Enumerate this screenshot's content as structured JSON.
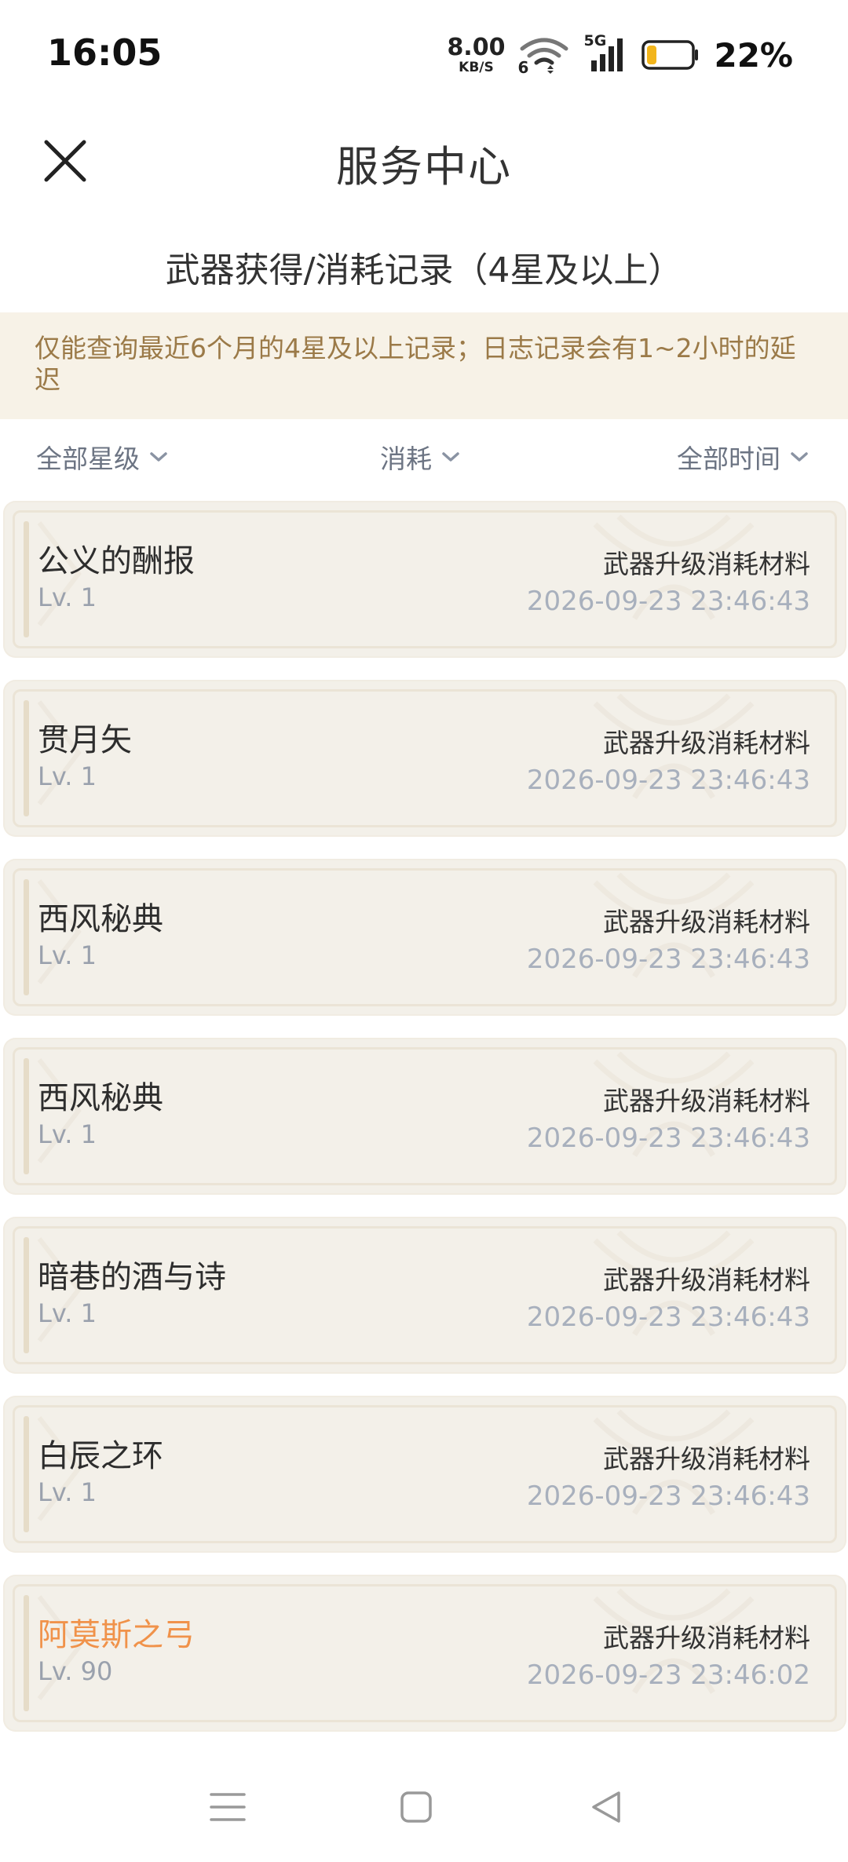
{
  "status_bar": {
    "time": "16:05",
    "net_speed_value": "8.00",
    "net_speed_unit": "KB/S",
    "wifi_sub": "6",
    "signal_label": "5G",
    "battery_percent": "22%",
    "battery_level": 0.22,
    "battery_color": "#f2b51c"
  },
  "header": {
    "title": "服务中心",
    "close_icon": "close-icon"
  },
  "section_title": "武器获得/消耗记录（4星及以上）",
  "notice": "仅能查询最近6个月的4星及以上记录；日志记录会有1~2小时的延迟",
  "filters": [
    {
      "label": "全部星级"
    },
    {
      "label": "消耗"
    },
    {
      "label": "全部时间"
    }
  ],
  "records": [
    {
      "name": "公义的酬报",
      "level": "Lv. 1",
      "reason": "武器升级消耗材料",
      "time": "2026-09-23 23:46:43",
      "rarity": "4"
    },
    {
      "name": "贯月矢",
      "level": "Lv. 1",
      "reason": "武器升级消耗材料",
      "time": "2026-09-23 23:46:43",
      "rarity": "4"
    },
    {
      "name": "西风秘典",
      "level": "Lv. 1",
      "reason": "武器升级消耗材料",
      "time": "2026-09-23 23:46:43",
      "rarity": "4"
    },
    {
      "name": "西风秘典",
      "level": "Lv. 1",
      "reason": "武器升级消耗材料",
      "time": "2026-09-23 23:46:43",
      "rarity": "4"
    },
    {
      "name": "暗巷的酒与诗",
      "level": "Lv. 1",
      "reason": "武器升级消耗材料",
      "time": "2026-09-23 23:46:43",
      "rarity": "4"
    },
    {
      "name": "白辰之环",
      "level": "Lv. 1",
      "reason": "武器升级消耗材料",
      "time": "2026-09-23 23:46:43",
      "rarity": "4"
    },
    {
      "name": "阿莫斯之弓",
      "level": "Lv. 90",
      "reason": "武器升级消耗材料",
      "time": "2026-09-23 23:46:02",
      "rarity": "5"
    }
  ],
  "colors": {
    "five_star_name": "#f0924a",
    "four_star_name": "#2d2d2d",
    "notice_bg": "#f7f2e7",
    "notice_text": "#9b7a48"
  },
  "nav_bar": {
    "menu_icon": "menu-icon",
    "home_icon": "home-icon",
    "back_icon": "back-icon"
  }
}
